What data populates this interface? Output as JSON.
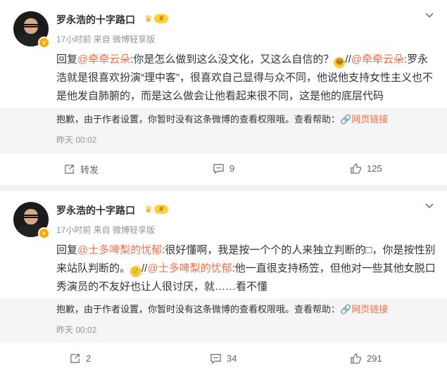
{
  "posts": [
    {
      "username": "罗永浩的十字路口",
      "level": "II",
      "meta": "17小时前  来自 微博轻享版",
      "content": {
        "p1": "回复",
        "m1": "@牵牵云朵",
        "p2": ":你是怎么做到这么没文化，又这么自信的？",
        "p3": "//",
        "m2": "@牵牵云朵",
        "p4": ":罗永浩就是很喜欢扮演“理中客”，很喜欢自己显得与众不同，他说他支持女性主义也不是他发自肺腑的，而是这么做会让他看起来很不同，这是他的底层代码"
      },
      "retweet": {
        "text": "抱歉，由于作者设置，你暂时没有这条微博的查看权限哦。查看帮助：",
        "link": "网页链接",
        "time": "昨天 00:02"
      },
      "actions": {
        "repost": "转发",
        "comments": "9",
        "likes": "125"
      }
    },
    {
      "username": "罗永浩的十字路口",
      "level": "II",
      "meta": "17小时前  来自 微博轻享版",
      "content": {
        "p1": "回复",
        "m1": "@士多啤梨的忧郁",
        "p2": ":很好懂啊，我是按一个个的人来独立判断的",
        "p3": "，你是按性别来站队判断的。",
        "p4": "//",
        "m2": "@士多啤梨的忧郁",
        "p5": ":他一直很支持杨笠，但他对一些其他女脱口秀演员的不友好也让人很讨厌，就……看不懂"
      },
      "retweet": {
        "text": "抱歉，由于作者设置，你暂时没有这条微博的查看权限哦。查看帮助：",
        "link": "网页链接",
        "time": "昨天 00:02"
      },
      "actions": {
        "repost": "2",
        "comments": "34",
        "likes": "291"
      }
    }
  ],
  "colors": {
    "mention": "#eb7350",
    "crown": "#f0a818",
    "verified": "#ffa600"
  },
  "icons": [
    "chevron-down-icon",
    "repost-icon",
    "comment-icon",
    "like-icon",
    "link-icon",
    "verified-icon",
    "crown-icon"
  ]
}
